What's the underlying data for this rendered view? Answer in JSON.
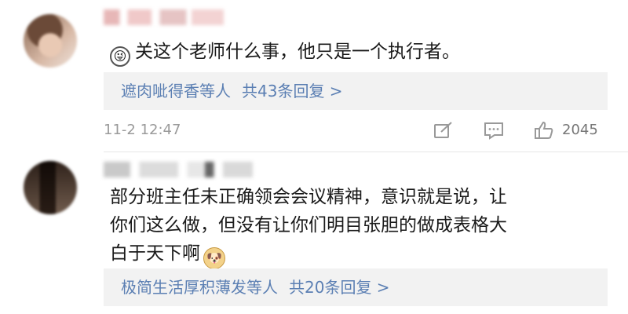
{
  "comments": [
    {
      "text": "关这个老师什么事，他只是一个执行者。",
      "emoji": "tongue-out-emoji",
      "replies": {
        "names": "遮肉呲得香等人",
        "count_text": "共43条回复 >"
      },
      "time": "11-2 12:47",
      "likes": "2045"
    },
    {
      "lines": [
        "部分班主任未正确领会会议精神，意识就是说，让",
        "你们这么做，但没有让你们明目张胆的做成表格大",
        "白于天下啊"
      ],
      "emoji": "doge-emoji",
      "replies": {
        "names": "极简生活厚积薄发等人",
        "count_text": "共20条回复 >"
      }
    }
  ]
}
